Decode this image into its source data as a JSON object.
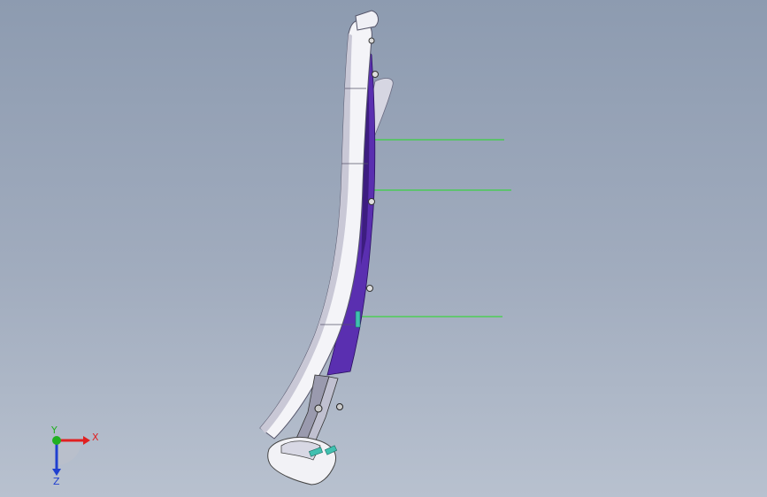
{
  "viewport": {
    "background_top": "#8d9bb0",
    "background_bottom": "#b8c1cf"
  },
  "part": {
    "body_color": "#f4f4f8",
    "inner_color": "#5a2fb0",
    "dark_color": "#3d1d80",
    "shadow_color": "#c9c8d6",
    "clip_color": "#40c0b0",
    "leader_color": "#22dd22"
  },
  "axis_triad": {
    "x_label": "X",
    "y_label": "Y",
    "z_label": "Z",
    "x_color": "#e02020",
    "y_color": "#20b020",
    "z_color": "#2040d0"
  }
}
